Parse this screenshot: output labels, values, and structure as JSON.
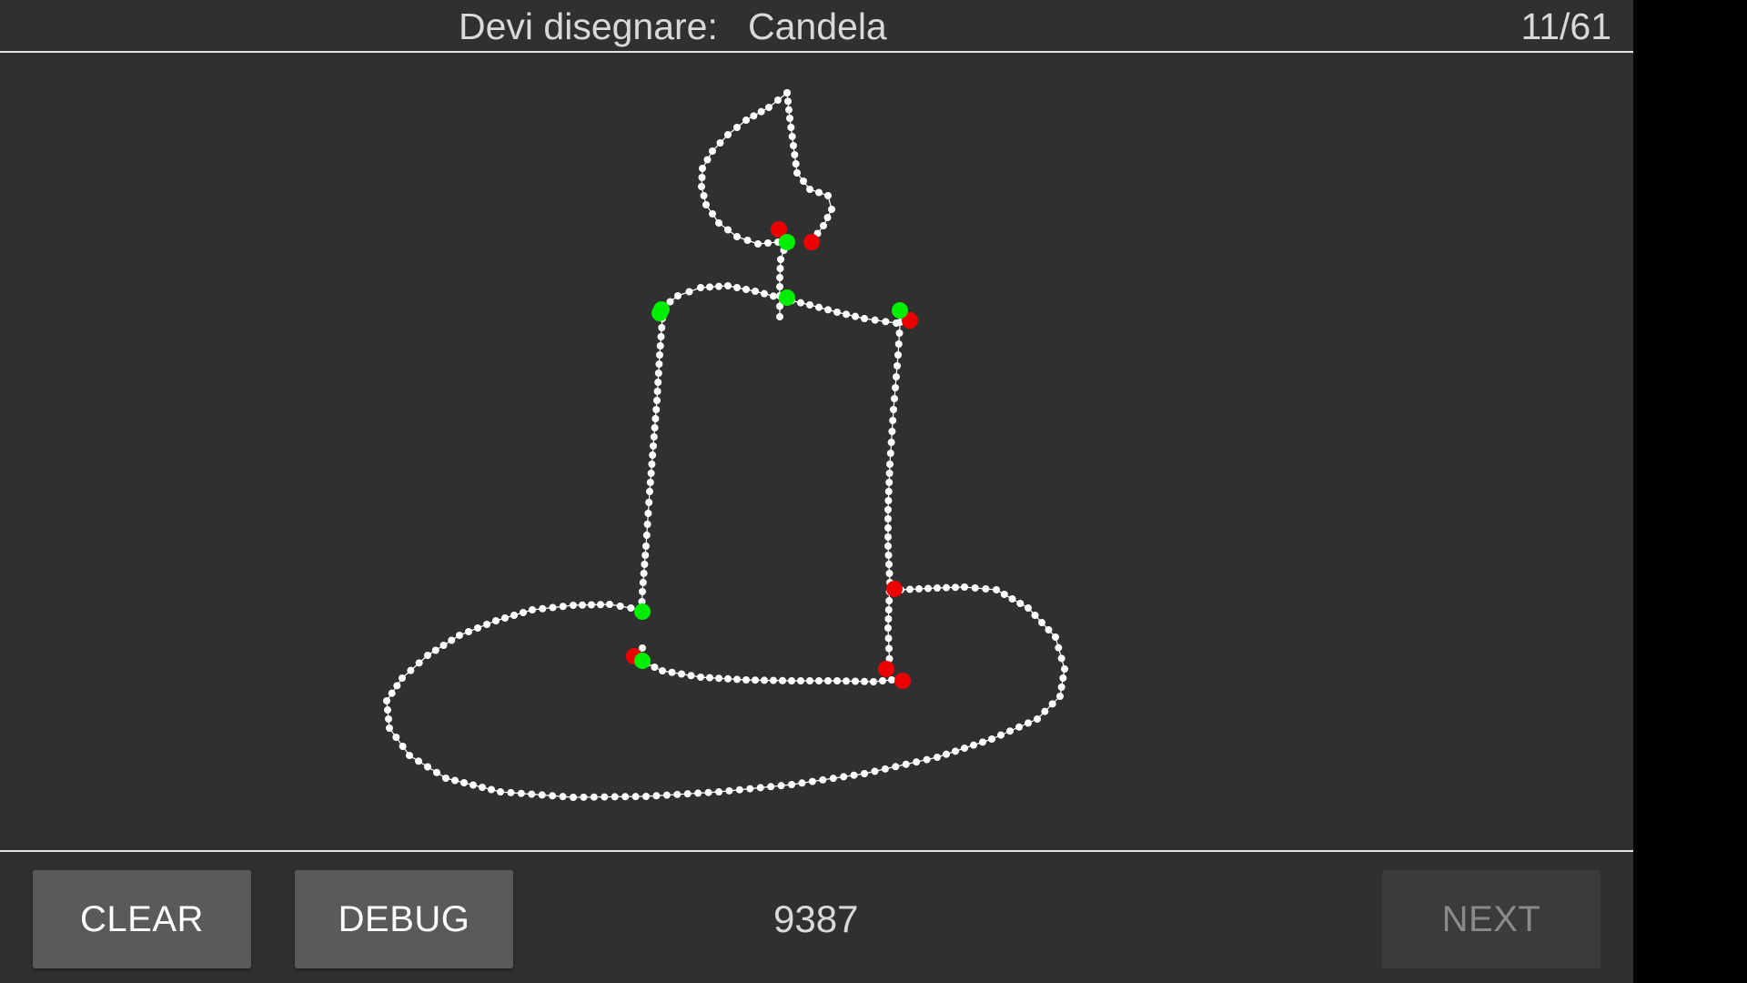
{
  "header": {
    "prompt_label": "Devi disegnare:",
    "prompt_word": "Candela",
    "counter": "11/61"
  },
  "footer": {
    "clear_label": "CLEAR",
    "debug_label": "DEBUG",
    "score": "9387",
    "next_label": "NEXT"
  },
  "colors": {
    "background": "#303030",
    "stroke": "#ffffff",
    "stroke_start_marker": "#00ee00",
    "stroke_end_marker": "#ee0000",
    "disabled_button": "#3b3b3b"
  }
}
